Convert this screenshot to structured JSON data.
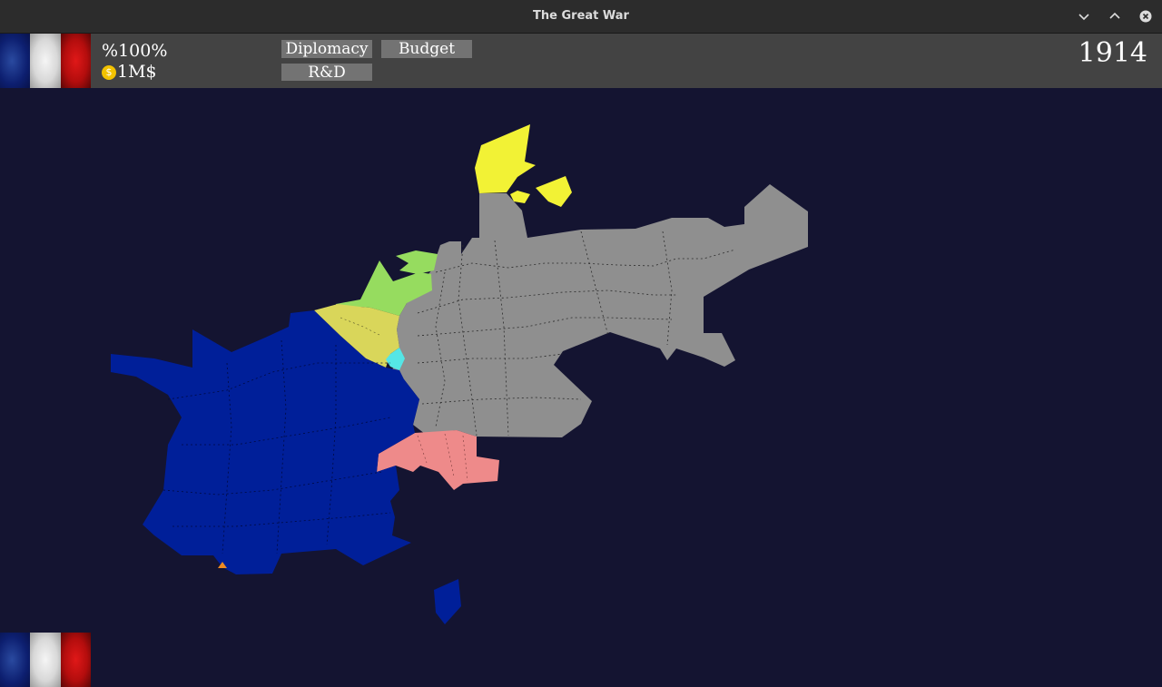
{
  "window": {
    "title": "The Great War"
  },
  "window_controls": {
    "minimize_icon": "chevron-down-icon",
    "maximize_icon": "chevron-up-icon",
    "close_icon": "close-circle-icon"
  },
  "hud": {
    "stability_symbol": "%",
    "stability_value": "100%",
    "money_icon": "coin-icon",
    "coin_glyph": "$",
    "money_value": "1M$",
    "buttons": {
      "diplomacy": "Diplomacy",
      "budget": "Budget",
      "rnd": "R&D"
    },
    "year": "1914"
  },
  "player_nation_flag": {
    "colors": [
      "#0d1f70",
      "#e8e8e8",
      "#c41010"
    ]
  },
  "map": {
    "background": "#141431",
    "nations": [
      {
        "name": "france",
        "color": "#001f99"
      },
      {
        "name": "germany",
        "color": "#8f8f8f"
      },
      {
        "name": "belgium",
        "color": "#d9d65a"
      },
      {
        "name": "netherlands",
        "color": "#96dc5f"
      },
      {
        "name": "denmark",
        "color": "#f2f235"
      },
      {
        "name": "switzerland",
        "color": "#ee8a8a"
      },
      {
        "name": "luxembourg",
        "color": "#55e6e6"
      },
      {
        "name": "corsica",
        "color": "#001f99"
      }
    ]
  }
}
